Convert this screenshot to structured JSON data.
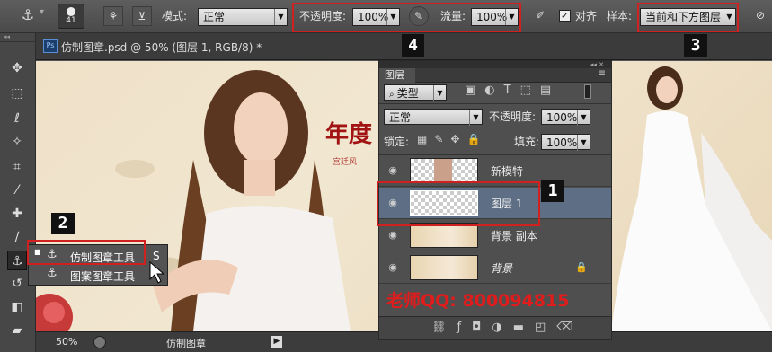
{
  "options_bar": {
    "brush_size": "41",
    "mode_label": "模式:",
    "mode_value": "正常",
    "opacity_label": "不透明度:",
    "opacity_value": "100%",
    "flow_label": "流量:",
    "flow_value": "100%",
    "align_label": "对齐",
    "sample_label": "样本:",
    "sample_value": "当前和下方图层"
  },
  "doc_tab": {
    "title": "仿制图章.psd @ 50% (图层 1, RGB/8) *",
    "ps_badge": "Ps"
  },
  "badges": {
    "one": "1",
    "two": "2",
    "three": "3",
    "four": "4"
  },
  "canvas": {
    "headline": "年度",
    "subtext": "宫廷风"
  },
  "layers_panel": {
    "tab": "图层",
    "filter_label": "类型",
    "blend_mode": "正常",
    "opacity_label": "不透明度:",
    "opacity_value": "100%",
    "lock_label": "锁定:",
    "fill_label": "填充:",
    "fill_value": "100%",
    "layers": [
      {
        "name": "新模特",
        "selected": false
      },
      {
        "name": "图层 1",
        "selected": true
      },
      {
        "name": "背景 副本",
        "selected": false
      },
      {
        "name": "背景",
        "selected": false
      }
    ],
    "watermark": "老师QQ: 800094815"
  },
  "tool_menu": {
    "items": [
      {
        "label": "仿制图章工具",
        "shortcut": "S"
      },
      {
        "label": "图案图章工具",
        "shortcut": ""
      }
    ]
  },
  "status": {
    "zoom": "50%",
    "doc_info": "仿制图章"
  },
  "colors": {
    "accent_red": "#d02020",
    "panel_bg": "#4f4f4f",
    "selected_row": "#5d6e85"
  }
}
